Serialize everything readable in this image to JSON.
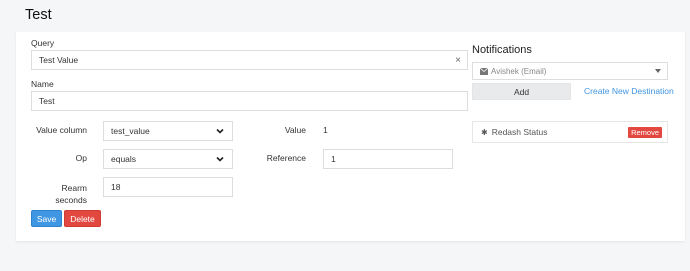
{
  "page": {
    "title": "Test"
  },
  "form": {
    "query_label": "Query",
    "query_value": "Test Value",
    "clear_icon": "×",
    "name_label": "Name",
    "name_value": "Test",
    "value_column_label": "Value column",
    "value_column_selected": "test_value",
    "value_label": "Value",
    "value_value": "1",
    "op_label": "Op",
    "op_selected": "equals",
    "reference_label": "Reference",
    "reference_value": "1",
    "rearm_label_line1": "Rearm",
    "rearm_label_line2": "seconds",
    "rearm_value": "18",
    "save_label": "Save",
    "delete_label": "Delete"
  },
  "notifications": {
    "title": "Notifications",
    "destination_placeholder": "Avishek (Email)",
    "add_label": "Add",
    "create_link": "Create New Destination",
    "destinations": [
      {
        "name": "Redash Status",
        "remove_label": "Remove",
        "icon": "gear-icon"
      }
    ]
  },
  "colors": {
    "primary": "#3f96e3",
    "danger": "#e2483f",
    "background": "#f5f6f8"
  }
}
